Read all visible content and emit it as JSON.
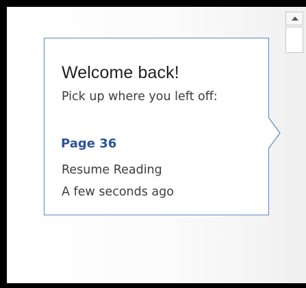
{
  "callout": {
    "title": "Welcome back!",
    "subtitle": "Pick up where you left off:",
    "page_link": "Page 36",
    "resume_label": "Resume Reading",
    "timestamp": "A few seconds ago"
  },
  "scrollbar": {
    "up_arrow_icon": "triangle-up-icon"
  },
  "colors": {
    "link": "#2c5597",
    "callout_border": "#5b87c5"
  }
}
